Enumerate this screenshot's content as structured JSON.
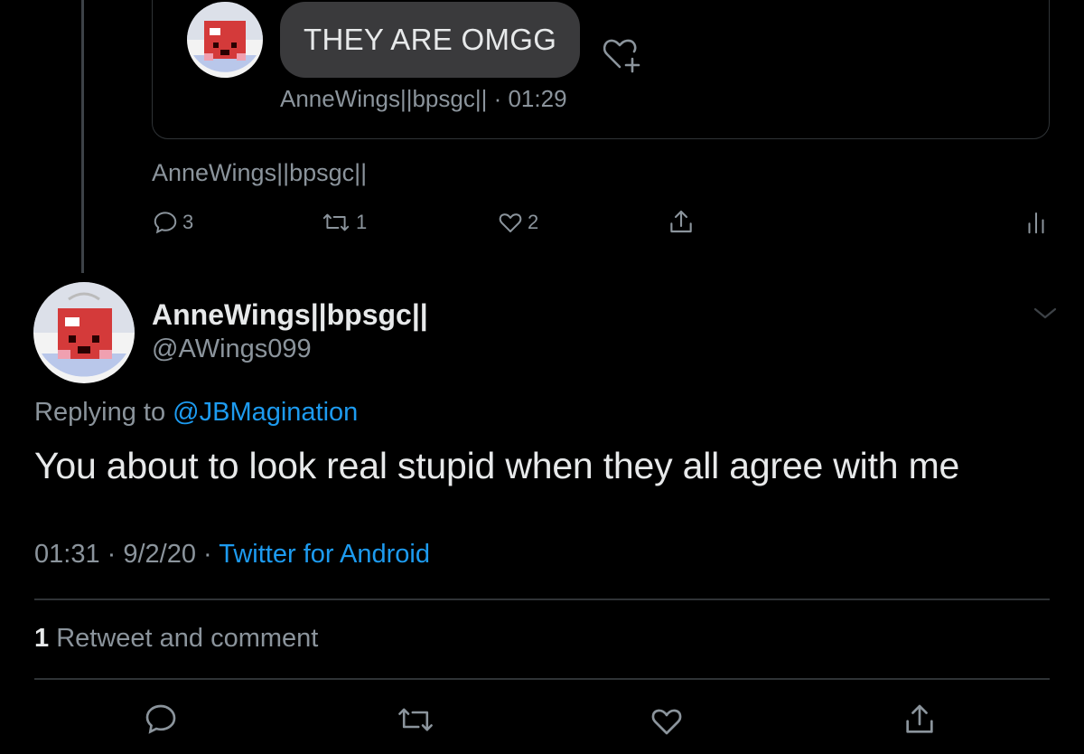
{
  "quoted": {
    "message": "THEY ARE OMGG",
    "sender": "AnneWings||bpsgc||",
    "time": "· 01:29"
  },
  "previous_tweet": {
    "author": "AnneWings||bpsgc||",
    "actions": {
      "reply_count": "3",
      "retweet_count": "1",
      "like_count": "2"
    }
  },
  "tweet": {
    "display_name": "AnneWings||bpsgc||",
    "handle": "@AWings099",
    "replying_prefix": "Replying to",
    "replying_to": "@JBMagination",
    "text": "You about to look real stupid when they all agree with me",
    "time": "01:31",
    "date": "9/2/20",
    "source": "Twitter for Android",
    "sep": " · "
  },
  "stats": {
    "count": "1",
    "label": "Retweet and comment"
  },
  "colors": {
    "background": "#000000",
    "accent": "#1d9bf0",
    "muted": "#8b949c",
    "bubble": "#3a3a3c"
  },
  "icons": [
    "reply-icon",
    "retweet-icon",
    "like-icon",
    "share-icon",
    "analytics-icon",
    "add-reaction-icon",
    "chevron-down-icon"
  ]
}
